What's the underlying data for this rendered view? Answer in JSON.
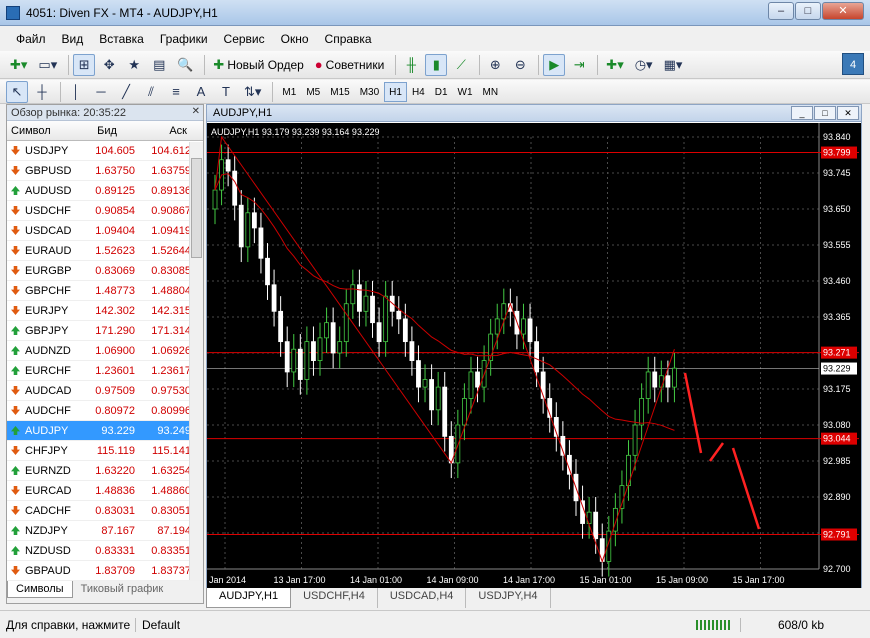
{
  "window": {
    "title": "4051: Diven FX - MT4 - AUDJPY,H1",
    "minimize": "–",
    "maximize": "□",
    "close": "✕"
  },
  "menu": [
    "Файл",
    "Вид",
    "Вставка",
    "Графики",
    "Сервис",
    "Окно",
    "Справка"
  ],
  "toolbar": {
    "new_order": "Новый Ордер",
    "advisors": "Советники",
    "badge": "4"
  },
  "timeframes": [
    "M1",
    "M5",
    "M15",
    "M30",
    "H1",
    "H4",
    "D1",
    "W1",
    "MN"
  ],
  "market_watch": {
    "title": "Обзор рынка: 20:35:22",
    "col_symbol": "Символ",
    "col_bid": "Бид",
    "col_ask": "Аск",
    "rows": [
      {
        "sym": "USDJPY",
        "bid": "104.605",
        "ask": "104.612",
        "dir": "down"
      },
      {
        "sym": "GBPUSD",
        "bid": "1.63750",
        "ask": "1.63759",
        "dir": "down"
      },
      {
        "sym": "AUDUSD",
        "bid": "0.89125",
        "ask": "0.89136",
        "dir": "up"
      },
      {
        "sym": "USDCHF",
        "bid": "0.90854",
        "ask": "0.90867",
        "dir": "down"
      },
      {
        "sym": "USDCAD",
        "bid": "1.09404",
        "ask": "1.09419",
        "dir": "down"
      },
      {
        "sym": "EURAUD",
        "bid": "1.52623",
        "ask": "1.52644",
        "dir": "down"
      },
      {
        "sym": "EURGBP",
        "bid": "0.83069",
        "ask": "0.83085",
        "dir": "down"
      },
      {
        "sym": "GBPCHF",
        "bid": "1.48773",
        "ask": "1.48804",
        "dir": "down"
      },
      {
        "sym": "EURJPY",
        "bid": "142.302",
        "ask": "142.315",
        "dir": "down"
      },
      {
        "sym": "GBPJPY",
        "bid": "171.290",
        "ask": "171.314",
        "dir": "up"
      },
      {
        "sym": "AUDNZD",
        "bid": "1.06900",
        "ask": "1.06926",
        "dir": "up"
      },
      {
        "sym": "EURCHF",
        "bid": "1.23601",
        "ask": "1.23617",
        "dir": "up"
      },
      {
        "sym": "AUDCAD",
        "bid": "0.97509",
        "ask": "0.97530",
        "dir": "down"
      },
      {
        "sym": "AUDCHF",
        "bid": "0.80972",
        "ask": "0.80996",
        "dir": "down"
      },
      {
        "sym": "AUDJPY",
        "bid": "93.229",
        "ask": "93.249",
        "dir": "up",
        "selected": true
      },
      {
        "sym": "CHFJPY",
        "bid": "115.119",
        "ask": "115.141",
        "dir": "down"
      },
      {
        "sym": "EURNZD",
        "bid": "1.63220",
        "ask": "1.63254",
        "dir": "up"
      },
      {
        "sym": "EURCAD",
        "bid": "1.48836",
        "ask": "1.48860",
        "dir": "down"
      },
      {
        "sym": "CADCHF",
        "bid": "0.83031",
        "ask": "0.83051",
        "dir": "down"
      },
      {
        "sym": "NZDJPY",
        "bid": "87.167",
        "ask": "87.194",
        "dir": "up"
      },
      {
        "sym": "NZDUSD",
        "bid": "0.83331",
        "ask": "0.83351",
        "dir": "up"
      },
      {
        "sym": "GBPAUD",
        "bid": "1.83709",
        "ask": "1.83737",
        "dir": "down"
      }
    ],
    "tabs": [
      "Символы",
      "Тиковый график"
    ]
  },
  "chart": {
    "window_title": "AUDJPY,H1",
    "info": "AUDJPY,H1  93.179 93.239 93.164 93.229",
    "bid_label": "93.229",
    "level_labels": [
      "93.799",
      "93.271",
      "93.044",
      "92.791"
    ],
    "tabs": [
      "AUDJPY,H1",
      "USDCHF,H4",
      "USDCAD,H4",
      "USDJPY,H4"
    ]
  },
  "chart_data": {
    "type": "candlestick",
    "y_ticks": [
      "93.840",
      "93.745",
      "93.650",
      "93.555",
      "93.460",
      "93.365",
      "93.270",
      "93.175",
      "93.080",
      "92.985",
      "92.890",
      "92.795",
      "92.700"
    ],
    "ylim": [
      92.7,
      93.84
    ],
    "x_labels": [
      "Jan 2014",
      "13 Jan 17:00",
      "14 Jan 01:00",
      "14 Jan 09:00",
      "14 Jan 17:00",
      "15 Jan 01:00",
      "15 Jan 09:00",
      "15 Jan 17:00"
    ],
    "levels": [
      93.799,
      93.271,
      93.044,
      92.791
    ],
    "current_price": 93.229,
    "up_color": "#44cc44",
    "down_color": "#ffffff",
    "bg_color": "#000000",
    "level_color": "#dd0000",
    "closes": [
      93.7,
      93.78,
      93.75,
      93.66,
      93.55,
      93.64,
      93.6,
      93.52,
      93.45,
      93.38,
      93.3,
      93.22,
      93.28,
      93.2,
      93.3,
      93.25,
      93.31,
      93.35,
      93.27,
      93.3,
      93.4,
      93.45,
      93.38,
      93.42,
      93.35,
      93.3,
      93.42,
      93.38,
      93.36,
      93.3,
      93.25,
      93.18,
      93.2,
      93.12,
      93.18,
      93.05,
      92.98,
      93.08,
      93.15,
      93.22,
      93.18,
      93.25,
      93.32,
      93.36,
      93.4,
      93.38,
      93.32,
      93.36,
      93.3,
      93.22,
      93.15,
      93.1,
      93.05,
      93.0,
      92.95,
      92.88,
      92.82,
      92.85,
      92.78,
      92.72,
      92.8,
      92.86,
      92.92,
      93.0,
      93.08,
      93.15,
      93.22,
      93.18,
      93.21,
      93.18,
      93.23
    ]
  },
  "status": {
    "help": "Для справки, нажмите",
    "profile": "Default",
    "traffic": "608/0 kb"
  }
}
